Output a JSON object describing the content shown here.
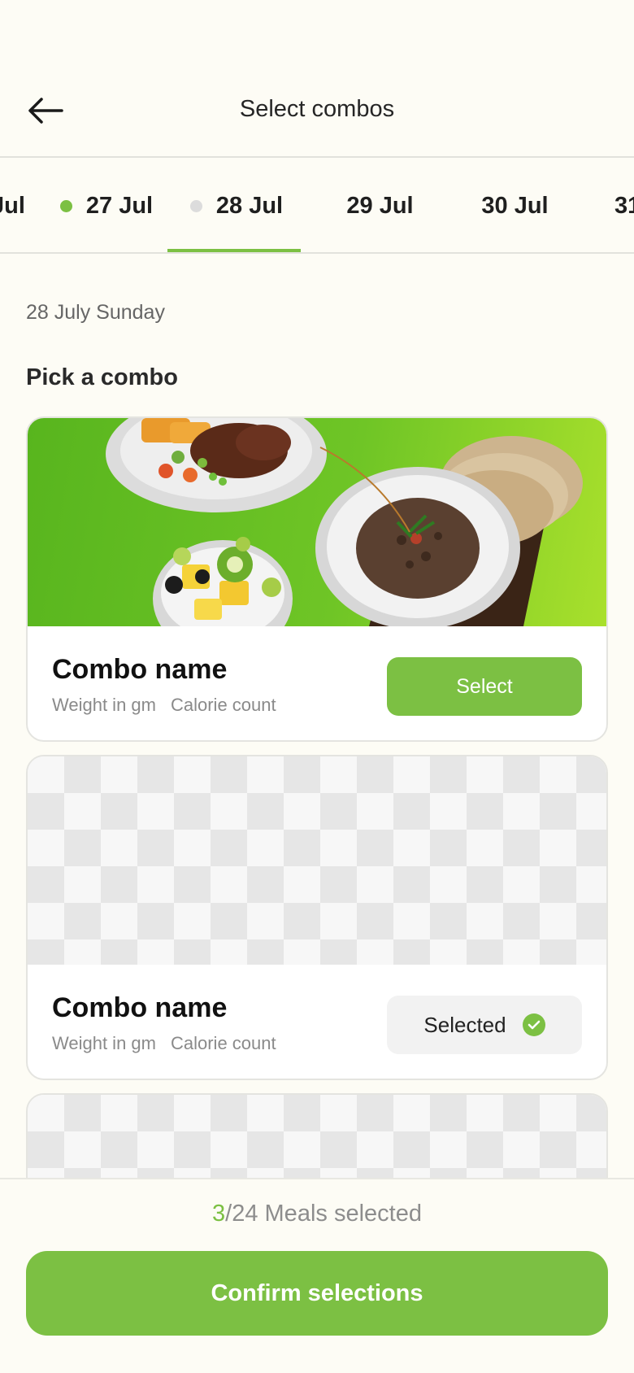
{
  "header": {
    "title": "Select combos",
    "back_icon": "arrow-left-icon"
  },
  "date_tabs": [
    {
      "label": "Jul",
      "dot_color": null
    },
    {
      "label": "27 Jul",
      "dot_color": "#7cc043"
    },
    {
      "label": "28 Jul",
      "dot_color": "#dcdcdc",
      "active": true
    },
    {
      "label": "29 Jul",
      "dot_color": null
    },
    {
      "label": "30 Jul",
      "dot_color": null
    },
    {
      "label": "31",
      "dot_color": null
    }
  ],
  "day_label": "28 July Sunday",
  "section_title": "Pick a combo",
  "combos": [
    {
      "name": "Combo name",
      "weight": "Weight in gm",
      "calories": "Calorie count",
      "action_label": "Select",
      "state": "unselected"
    },
    {
      "name": "Combo name",
      "weight": "Weight in gm",
      "calories": "Calorie count",
      "action_label": "Selected",
      "state": "selected"
    }
  ],
  "footer": {
    "selected_count": "3",
    "total_text": "/24 Meals selected",
    "confirm_label": "Confirm selections"
  },
  "colors": {
    "accent": "#7cc043",
    "background": "#fdfcf5"
  }
}
